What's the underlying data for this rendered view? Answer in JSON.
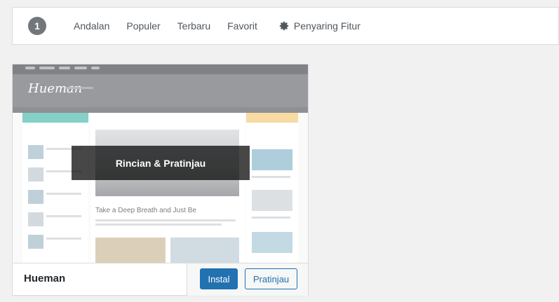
{
  "filter_bar": {
    "count": "1",
    "links": [
      "Andalan",
      "Populer",
      "Terbaru",
      "Favorit"
    ],
    "feature_filter_label": "Penyaring Fitur",
    "feature_filter_icon": "gear-icon"
  },
  "theme_card": {
    "screenshot": {
      "logo_text": "Hueman",
      "hero_title": "Take a Deep Breath and Just Be"
    },
    "overlay_label": "Rincian & Pratinjau",
    "name": "Hueman",
    "install_label": "Instal",
    "preview_label": "Pratinjau"
  },
  "colors": {
    "primary_button": "#2271b1",
    "overlay": "rgba(0,0,0,0.72)",
    "accent_teal": "#3bb3a5",
    "accent_yellow": "#f2c66b"
  }
}
